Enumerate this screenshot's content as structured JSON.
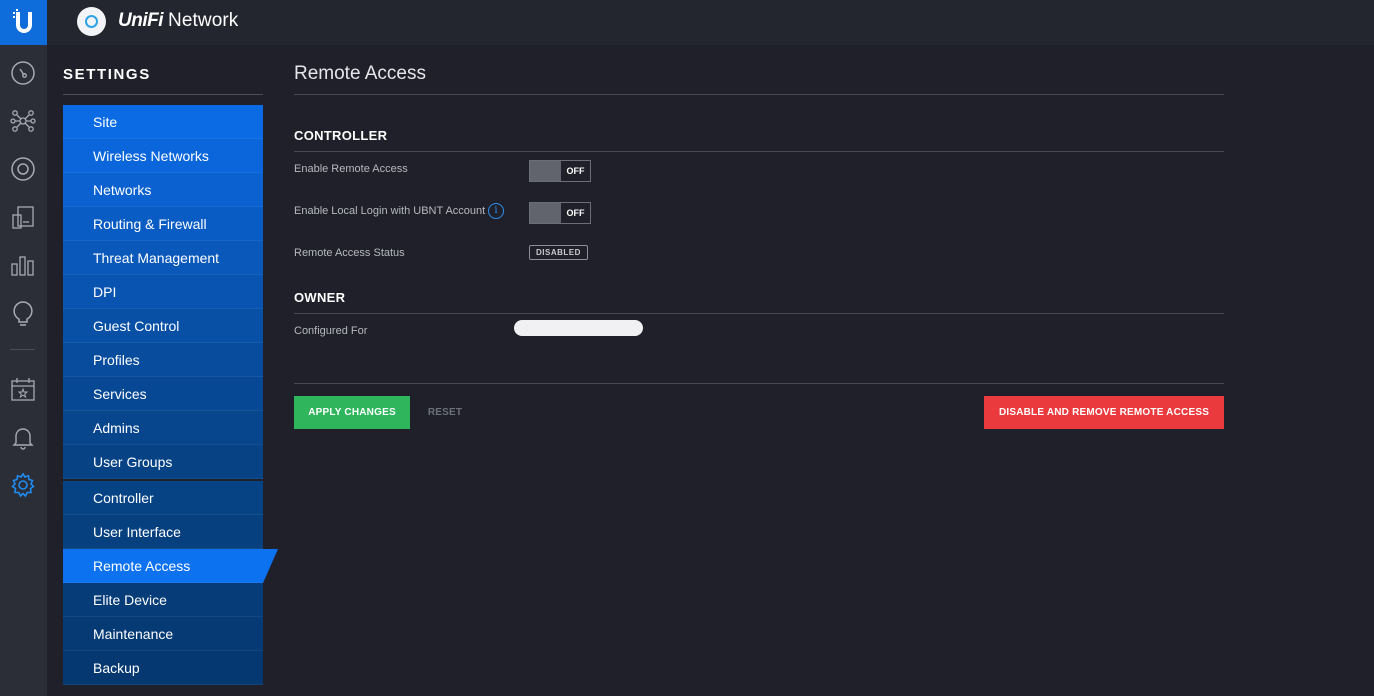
{
  "app": {
    "brand": "UniFi",
    "name": "Network"
  },
  "rail": {
    "items": [
      {
        "icon": "dashboard-icon"
      },
      {
        "icon": "topology-icon"
      },
      {
        "icon": "devices-icon"
      },
      {
        "icon": "clients-icon"
      },
      {
        "icon": "statistics-icon"
      },
      {
        "icon": "insights-icon"
      },
      {
        "icon": "events-icon"
      },
      {
        "icon": "alerts-icon"
      },
      {
        "icon": "settings-icon",
        "active": true
      }
    ]
  },
  "settings": {
    "title": "SETTINGS",
    "site_group": [
      {
        "label": "Site"
      },
      {
        "label": "Wireless Networks"
      },
      {
        "label": "Networks"
      },
      {
        "label": "Routing & Firewall"
      },
      {
        "label": "Threat Management"
      },
      {
        "label": "DPI"
      },
      {
        "label": "Guest Control"
      },
      {
        "label": "Profiles"
      },
      {
        "label": "Services"
      },
      {
        "label": "Admins"
      },
      {
        "label": "User Groups"
      }
    ],
    "controller_group": [
      {
        "label": "Controller"
      },
      {
        "label": "User Interface"
      },
      {
        "label": "Remote Access",
        "active": true
      },
      {
        "label": "Elite Device"
      },
      {
        "label": "Maintenance"
      },
      {
        "label": "Backup"
      }
    ]
  },
  "main": {
    "title": "Remote Access",
    "controller": {
      "heading": "CONTROLLER",
      "enable_remote_access": {
        "label": "Enable Remote Access",
        "state": "OFF"
      },
      "enable_local_login": {
        "label": "Enable Local Login with UBNT Account",
        "state": "OFF",
        "info_glyph": "i"
      },
      "status": {
        "label": "Remote Access Status",
        "value": "DISABLED"
      }
    },
    "owner": {
      "heading": "OWNER",
      "configured_for": {
        "label": "Configured For"
      }
    },
    "actions": {
      "apply": "APPLY CHANGES",
      "reset": "RESET",
      "disable_remove": "DISABLE AND REMOVE REMOTE ACCESS"
    }
  },
  "colors": {
    "accent": "#0d72f0",
    "apply": "#2fb65c",
    "danger": "#ea3a3d",
    "background": "#1f2029"
  }
}
